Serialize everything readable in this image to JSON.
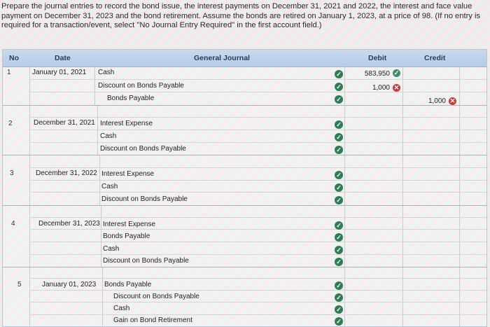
{
  "prompt": "Prepare the journal entries to record the bond issue, the interest payments on December 31, 2021 and 2022, the interest and face value payment on December 31, 2023 and the bond retirement. Assume the bonds are retired on January 1, 2023, at a price of 98. (If no entry is required for a transaction/event, select \"No Journal Entry Required\" in the first account field.)",
  "header": {
    "no": "No",
    "date": "Date",
    "journal": "General Journal",
    "debit": "Debit",
    "credit": "Credit"
  },
  "entries": [
    {
      "no": "1",
      "date": "January 01, 2021",
      "accounts": [
        "Cash",
        "Discount on Bonds Payable",
        "Bonds Payable"
      ],
      "debits": [
        "583,950",
        "1,000",
        ""
      ],
      "credits": [
        "",
        "",
        "1,000"
      ]
    },
    {
      "no": "2",
      "date": "December 31, 2021",
      "accounts": [
        "Interest Expense",
        "Cash",
        "Discount on Bonds Payable"
      ]
    },
    {
      "no": "3",
      "date": "December 31, 2022",
      "accounts": [
        "Interest Expense",
        "Cash",
        "Discount on Bonds Payable"
      ]
    },
    {
      "no": "4",
      "date": "December 31, 2023",
      "accounts": [
        "Interest Expense",
        "Bonds Payable",
        "Cash",
        "Discount on Bonds Payable"
      ]
    },
    {
      "no": "5",
      "date": "January 01, 2023",
      "accounts": [
        "Bonds Payable",
        "Discount on Bonds Payable",
        "Cash",
        "Gain on Bond Retirement"
      ]
    }
  ],
  "colors": {
    "check": "#2f7d57",
    "error": "#c73b3b",
    "header_bg": "#c3d4ec"
  }
}
